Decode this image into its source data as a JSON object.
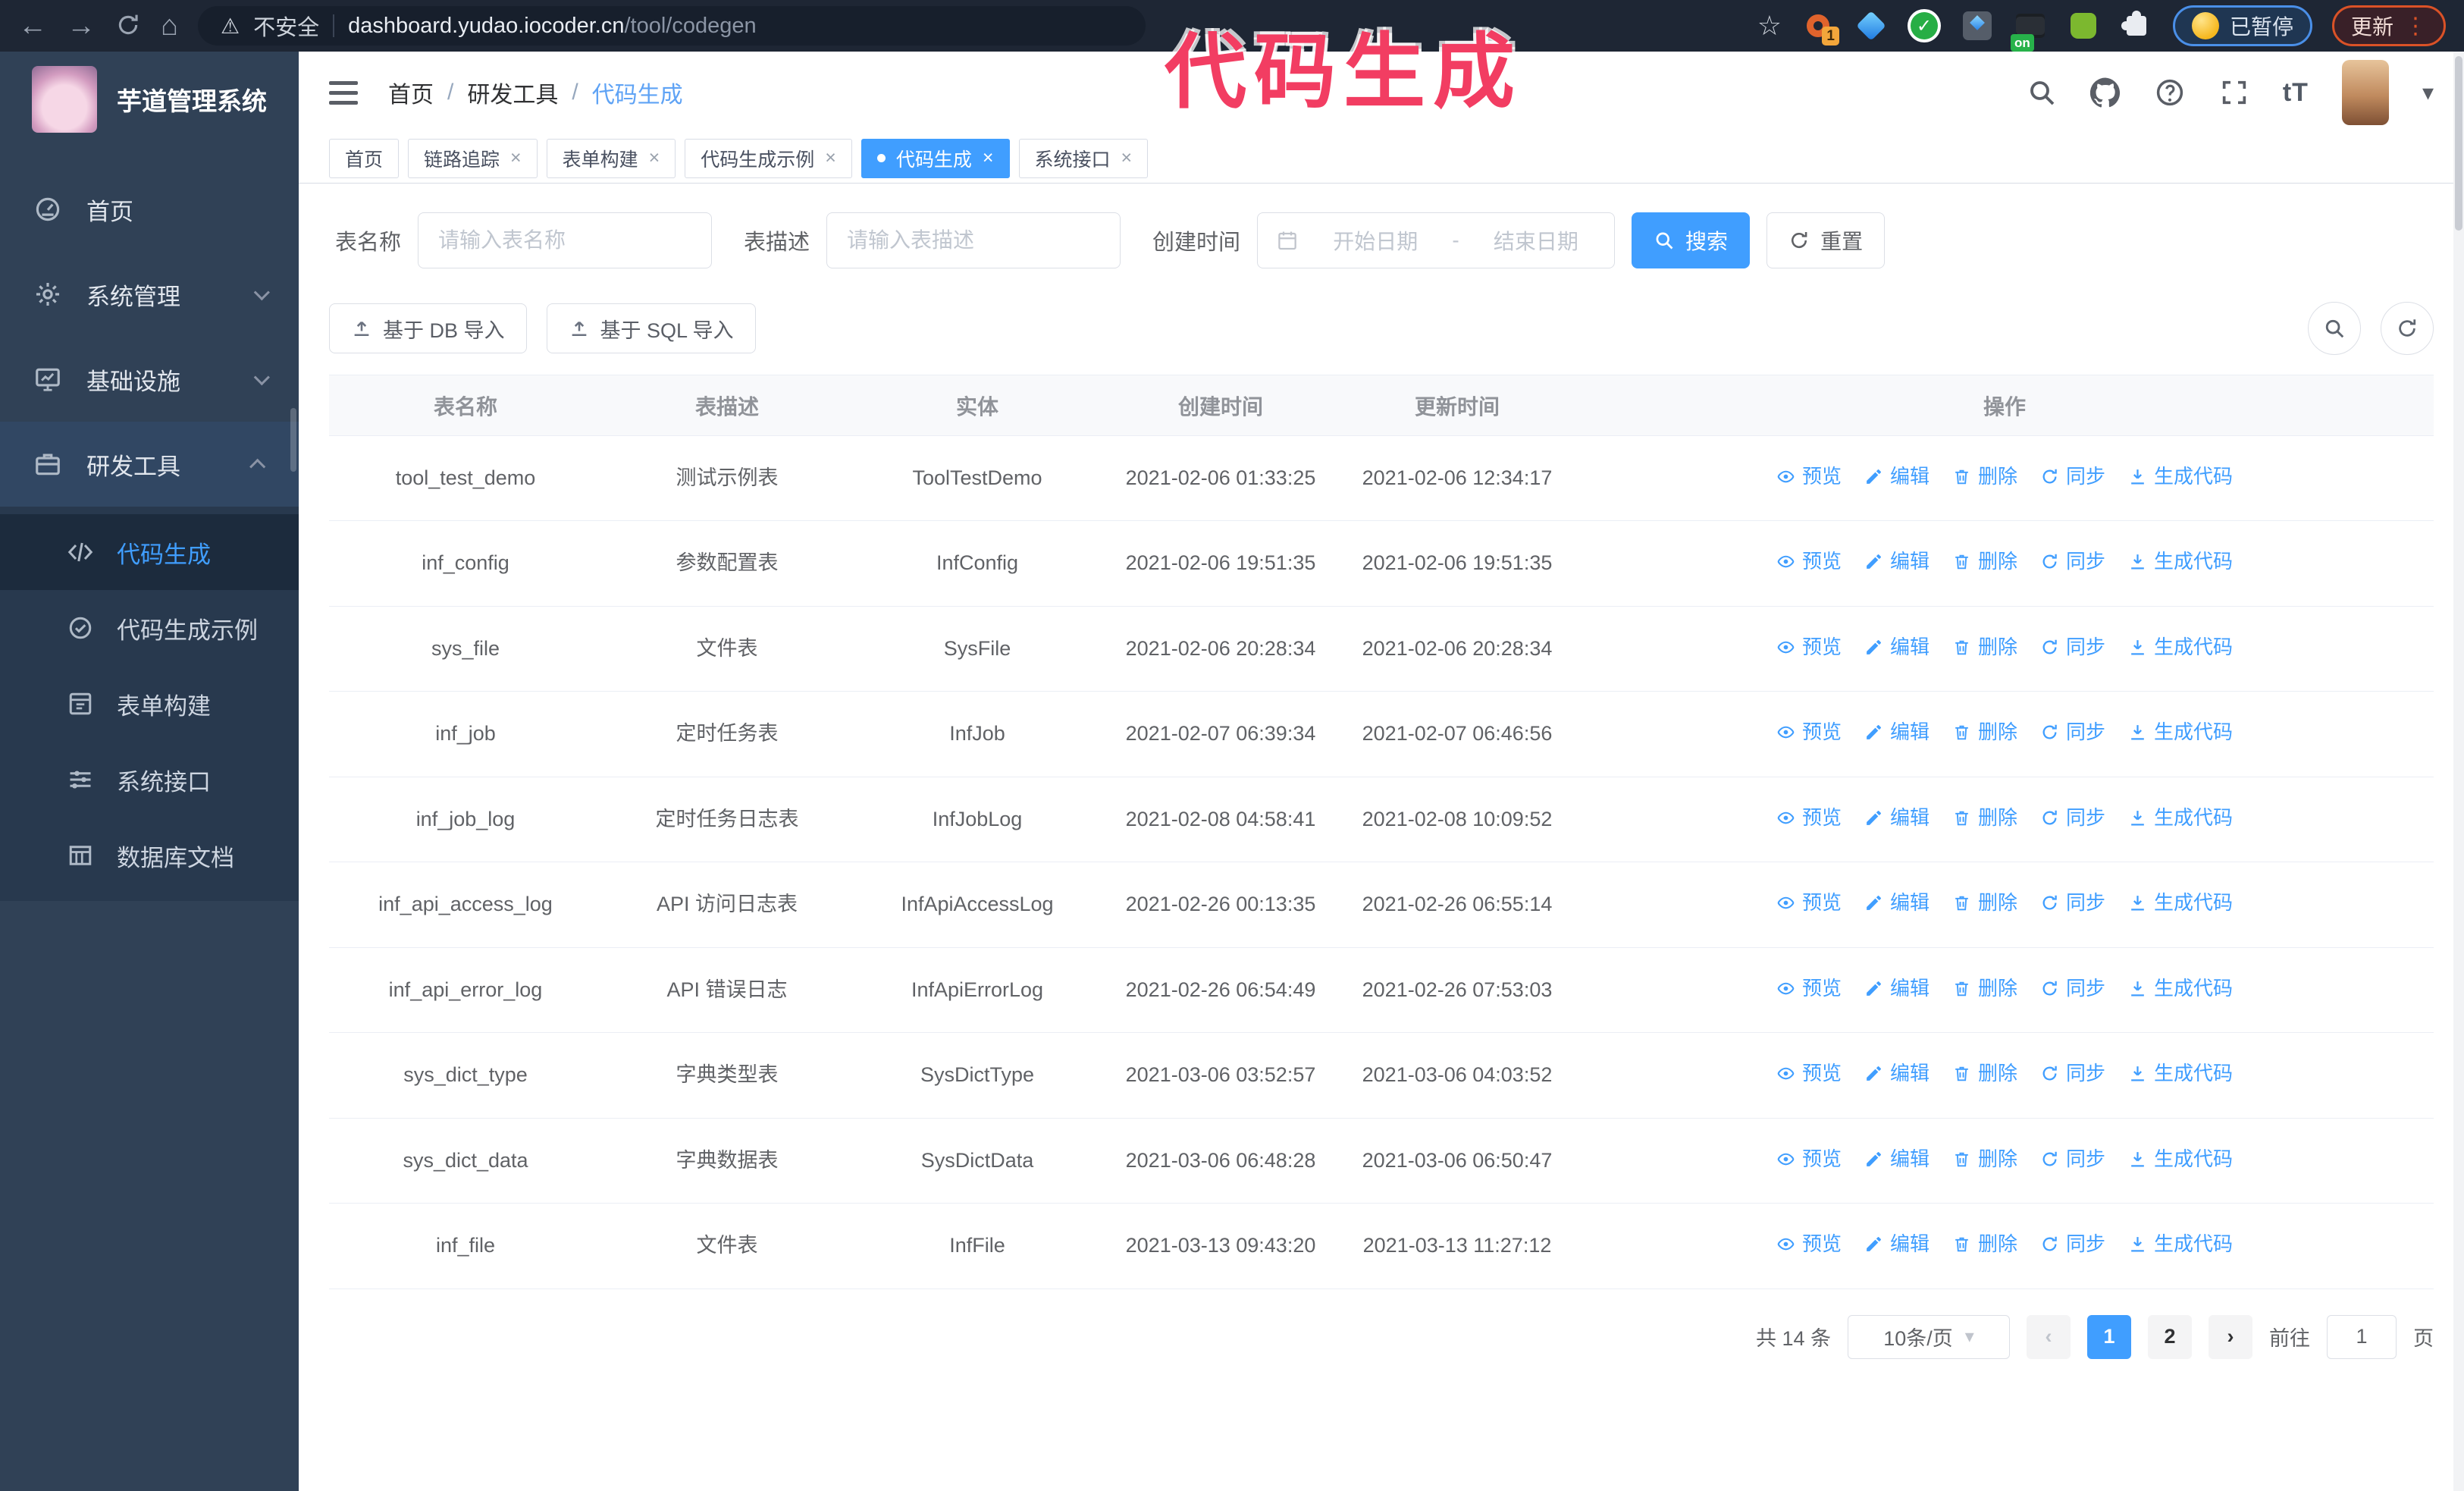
{
  "watermark": "代码生成",
  "colors": {
    "accent": "#409eff",
    "sidebar": "#304156",
    "watermark_pink": "#f23d62",
    "chrome_bg": "#1e2634"
  },
  "browser": {
    "security_label": "不安全",
    "url_domain": "dashboard.yudao.iocoder.cn",
    "url_path": "/tool/codegen",
    "ext_badge": "1",
    "ext_on_badge": "on",
    "paused_label": "已暂停",
    "update_label": "更新"
  },
  "sidebar": {
    "logo_title": "芋道管理系统",
    "items": [
      {
        "label": "首页"
      },
      {
        "label": "系统管理"
      },
      {
        "label": "基础设施"
      },
      {
        "label": "研发工具"
      }
    ],
    "submenu": [
      {
        "label": "代码生成"
      },
      {
        "label": "代码生成示例"
      },
      {
        "label": "表单构建"
      },
      {
        "label": "系统接口"
      },
      {
        "label": "数据库文档"
      }
    ]
  },
  "header": {
    "breadcrumb": [
      "首页",
      "研发工具",
      "代码生成"
    ],
    "font_size_icon": "tT"
  },
  "tabs": [
    {
      "label": "首页"
    },
    {
      "label": "链路追踪"
    },
    {
      "label": "表单构建"
    },
    {
      "label": "代码生成示例"
    },
    {
      "label": "代码生成"
    },
    {
      "label": "系统接口"
    }
  ],
  "filters": {
    "table_name_label": "表名称",
    "table_name_placeholder": "请输入表名称",
    "table_desc_label": "表描述",
    "table_desc_placeholder": "请输入表描述",
    "create_time_label": "创建时间",
    "start_placeholder": "开始日期",
    "range_separator": "-",
    "end_placeholder": "结束日期",
    "search_label": "搜索",
    "reset_label": "重置"
  },
  "toolbar": {
    "db_import_label": "基于 DB 导入",
    "sql_import_label": "基于 SQL 导入"
  },
  "table": {
    "columns": [
      "表名称",
      "表描述",
      "实体",
      "创建时间",
      "更新时间",
      "操作"
    ],
    "actions": [
      "预览",
      "编辑",
      "删除",
      "同步",
      "生成代码"
    ],
    "rows": [
      {
        "name": "tool_test_demo",
        "desc": "测试示例表",
        "entity": "ToolTestDemo",
        "created": "2021-02-06 01:33:25",
        "updated": "2021-02-06 12:34:17"
      },
      {
        "name": "inf_config",
        "desc": "参数配置表",
        "entity": "InfConfig",
        "created": "2021-02-06 19:51:35",
        "updated": "2021-02-06 19:51:35"
      },
      {
        "name": "sys_file",
        "desc": "文件表",
        "entity": "SysFile",
        "created": "2021-02-06 20:28:34",
        "updated": "2021-02-06 20:28:34"
      },
      {
        "name": "inf_job",
        "desc": "定时任务表",
        "entity": "InfJob",
        "created": "2021-02-07 06:39:34",
        "updated": "2021-02-07 06:46:56"
      },
      {
        "name": "inf_job_log",
        "desc": "定时任务日志表",
        "entity": "InfJobLog",
        "created": "2021-02-08 04:58:41",
        "updated": "2021-02-08 10:09:52"
      },
      {
        "name": "inf_api_access_log",
        "desc": "API 访问日志表",
        "entity": "InfApiAccessLog",
        "created": "2021-02-26 00:13:35",
        "updated": "2021-02-26 06:55:14"
      },
      {
        "name": "inf_api_error_log",
        "desc": "API 错误日志",
        "entity": "InfApiErrorLog",
        "created": "2021-02-26 06:54:49",
        "updated": "2021-02-26 07:53:03"
      },
      {
        "name": "sys_dict_type",
        "desc": "字典类型表",
        "entity": "SysDictType",
        "created": "2021-03-06 03:52:57",
        "updated": "2021-03-06 04:03:52"
      },
      {
        "name": "sys_dict_data",
        "desc": "字典数据表",
        "entity": "SysDictData",
        "created": "2021-03-06 06:48:28",
        "updated": "2021-03-06 06:50:47"
      },
      {
        "name": "inf_file",
        "desc": "文件表",
        "entity": "InfFile",
        "created": "2021-03-13 09:43:20",
        "updated": "2021-03-13 11:27:12"
      }
    ]
  },
  "pagination": {
    "total_label": "共 14 条",
    "page_size_label": "10条/页",
    "pages": [
      "1",
      "2"
    ],
    "goto_label": "前往",
    "goto_value": "1",
    "page_unit": "页"
  }
}
